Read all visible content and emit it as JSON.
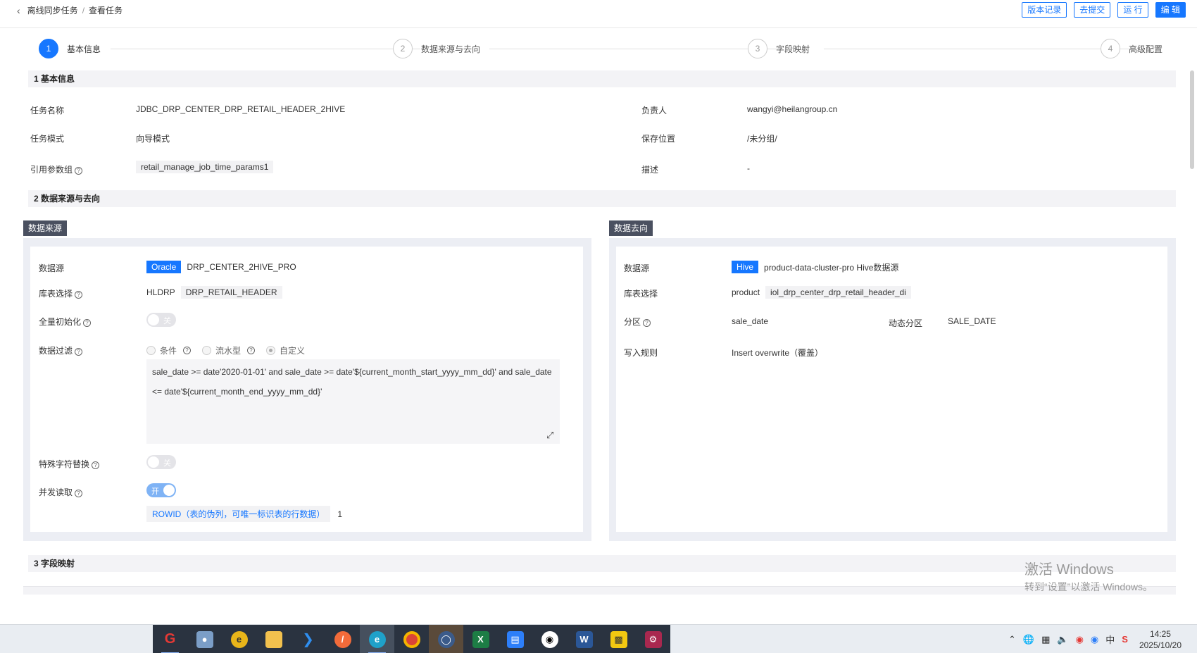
{
  "breadcrumb": {
    "parent": "离线同步任务",
    "sep": "/",
    "current": "查看任务"
  },
  "actions": {
    "versions": "版本记录",
    "submit": "去提交",
    "run": "运 行",
    "edit": "编 辑"
  },
  "steps": [
    {
      "num": "1",
      "label": "基本信息"
    },
    {
      "num": "2",
      "label": "数据来源与去向"
    },
    {
      "num": "3",
      "label": "字段映射"
    },
    {
      "num": "4",
      "label": "高级配置"
    }
  ],
  "sections": {
    "basic": "1 基本信息",
    "source": "2 数据来源与去向",
    "mapping": "3 字段映射"
  },
  "basic": {
    "task_name_label": "任务名称",
    "task_name": "JDBC_DRP_CENTER_DRP_RETAIL_HEADER_2HIVE",
    "owner_label": "负责人",
    "owner": "wangyi@heilangroup.cn",
    "mode_label": "任务模式",
    "mode": "向导模式",
    "save_label": "保存位置",
    "save": "/未分组/",
    "params_label": "引用参数组",
    "params": "retail_manage_job_time_params1",
    "desc_label": "描述",
    "desc": "-"
  },
  "source": {
    "tag": "数据来源",
    "ds_label": "数据源",
    "ds_type": "Oracle",
    "ds_name": "DRP_CENTER_2HIVE_PRO",
    "table_label": "库表选择",
    "schema": "HLDRP",
    "table": "DRP_RETAIL_HEADER",
    "full_init_label": "全量初始化",
    "full_init": "关",
    "filter_label": "数据过滤",
    "filter_opts": [
      "条件",
      "流水型",
      "自定义"
    ],
    "filter_sql_1": "sale_date >= date'2020-01-01' and sale_date >= date'${current_month_start_yyyy_mm_dd}' and sale_date",
    "filter_sql_2": "<= date'${current_month_end_yyyy_mm_dd}'",
    "special_label": "特殊字符替换",
    "special": "关",
    "concurrent_label": "并发读取",
    "concurrent": "开",
    "rowid_text": "ROWID（表的伪列，可唯一标识表的行数据）",
    "rowid_value": "1"
  },
  "target": {
    "tag": "数据去向",
    "ds_label": "数据源",
    "ds_type": "Hive",
    "ds_name": "product-data-cluster-pro Hive数据源",
    "table_label": "库表选择",
    "schema": "product",
    "table": "iol_drp_center_drp_retail_header_di",
    "partition_label": "分区",
    "partition": "sale_date",
    "dyn_label": "动态分区",
    "dyn": "SALE_DATE",
    "write_label": "写入规则",
    "write": "Insert overwrite（覆盖）"
  },
  "activate": {
    "line1": "激活 Windows",
    "line2": "转到“设置”以激活 Windows。"
  },
  "taskbar": {
    "time": "14:25",
    "date": "2025/10/20",
    "ime": "中"
  }
}
